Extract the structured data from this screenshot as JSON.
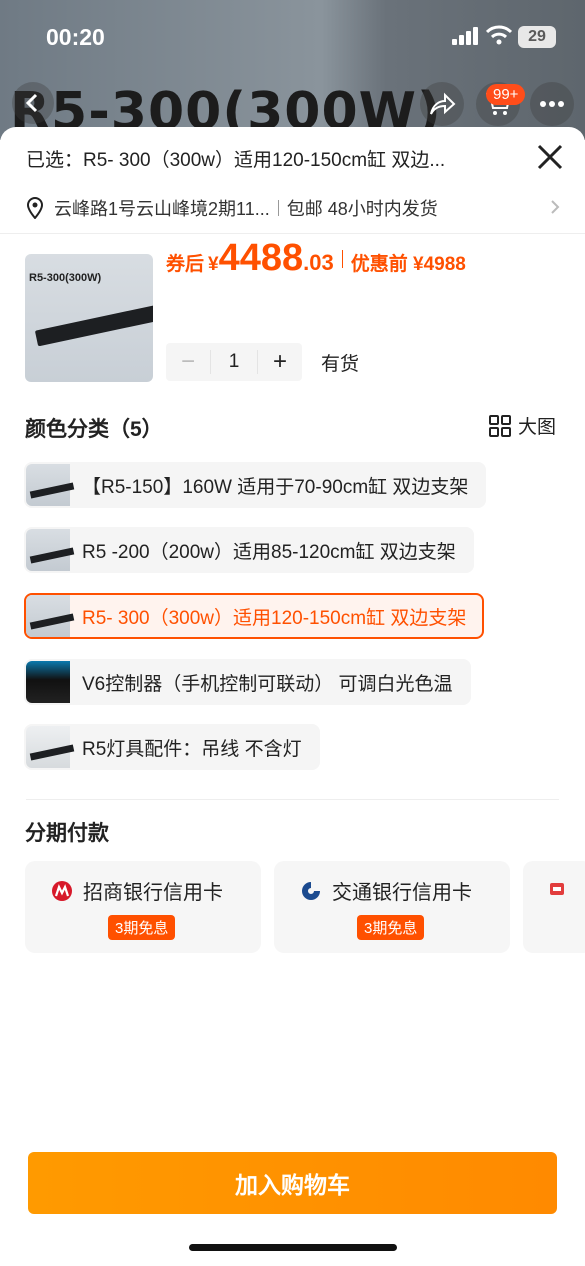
{
  "status_bar": {
    "time": "00:20",
    "battery": "29"
  },
  "backdrop": {
    "title": "R5-300(300W)",
    "cart_badge": "99+"
  },
  "sheet": {
    "selected": "已选：R5- 300（300w）适用120-150cm缸 双边...",
    "address": "云峰路1号云山峰境2期11...",
    "shipping": "包邮 48小时内发货",
    "product_image_title": "R5-300(300W)",
    "price_label": "券后",
    "price_currency": "¥",
    "price_int": "4488",
    "price_dec": ".03",
    "price_before": "优惠前 ¥4988",
    "quantity": "1",
    "minus": "−",
    "plus": "+",
    "stock": "有货",
    "color_title": "颜色分类（5）",
    "big_view": "大图",
    "options": [
      {
        "label": "【R5-150】160W 适用于70-90cm缸 双边支架",
        "selected": false
      },
      {
        "label": "R5 -200（200w）适用85-120cm缸 双边支架",
        "selected": false
      },
      {
        "label": "R5- 300（300w）适用120-150cm缸 双边支架",
        "selected": true
      },
      {
        "label": "V6控制器（手机控制可联动） 可调白光色温",
        "selected": false
      },
      {
        "label": "R5灯具配件：吊线 不含灯",
        "selected": false
      }
    ],
    "installment_title": "分期付款",
    "installment_cards": [
      {
        "bank": "招商银行信用卡",
        "tag": "3期免息"
      },
      {
        "bank": "交通银行信用卡",
        "tag": "3期免息"
      }
    ],
    "add_to_cart": "加入购物车"
  },
  "colors": {
    "accent": "#ff5000",
    "button": "#ff9000"
  }
}
